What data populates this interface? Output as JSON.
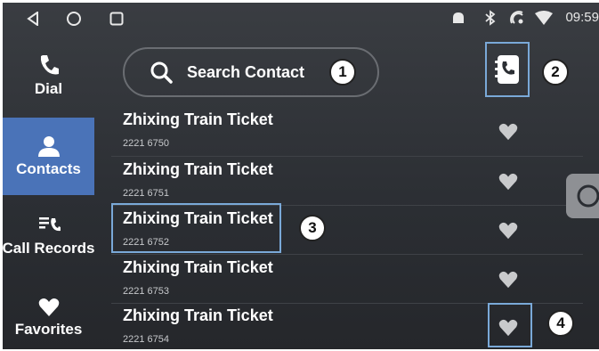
{
  "status_bar": {
    "nav_icons": [
      "back-icon",
      "home-icon",
      "recents-icon"
    ],
    "status_icons": [
      "notification-icon",
      "bluetooth-icon",
      "hotspot-icon",
      "wifi-icon"
    ],
    "time": "09:59"
  },
  "sidebar": {
    "items": [
      {
        "label": "Dial",
        "icon": "phone-icon",
        "active": false
      },
      {
        "label": "Contacts",
        "icon": "person-icon",
        "active": true
      },
      {
        "label": "Call Records",
        "icon": "call-log-icon",
        "active": false
      },
      {
        "label": "Favorites",
        "icon": "heart-icon",
        "active": false
      }
    ]
  },
  "search": {
    "placeholder": "Search Contact",
    "icon": "search-icon"
  },
  "phonebook_button": {
    "icon": "phonebook-icon"
  },
  "contacts": [
    {
      "name": "Zhixing Train Ticket",
      "number": "2221 6750",
      "favorite": false
    },
    {
      "name": "Zhixing Train Ticket",
      "number": "2221 6751",
      "favorite": false
    },
    {
      "name": "Zhixing Train Ticket",
      "number": "2221 6752",
      "favorite": false
    },
    {
      "name": "Zhixing Train Ticket",
      "number": "2221 6753",
      "favorite": false
    },
    {
      "name": "Zhixing Train Ticket",
      "number": "2221 6754",
      "favorite": false
    }
  ],
  "callouts": [
    "1",
    "2",
    "3",
    "4"
  ],
  "colors": {
    "accent": "#4a73b8",
    "highlight": "#7aa9d8",
    "heart": "#c9cacc"
  }
}
